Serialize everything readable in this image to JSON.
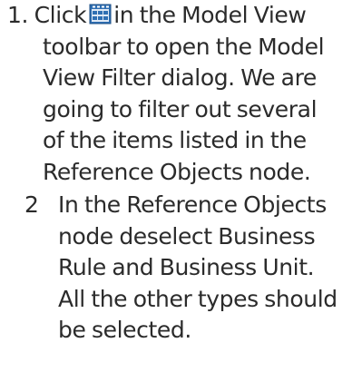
{
  "steps": [
    {
      "number": "1.",
      "lines": [
        "Click",
        "in the Model View",
        "toolbar to open the Model",
        "View Filter dialog. We are",
        "going to filter out several",
        "of the items listed in the",
        "Reference Objects node."
      ],
      "icon": "model-view-filter-icon"
    },
    {
      "number": "2",
      "lines": [
        "In the Reference Objects",
        "node deselect Business",
        "Rule and Business Unit.",
        "All the other types should",
        "be selected."
      ]
    }
  ],
  "colors": {
    "text": "#2b2b2b",
    "icon_blue": "#2f6fb3",
    "icon_light": "#dfe9f5"
  }
}
